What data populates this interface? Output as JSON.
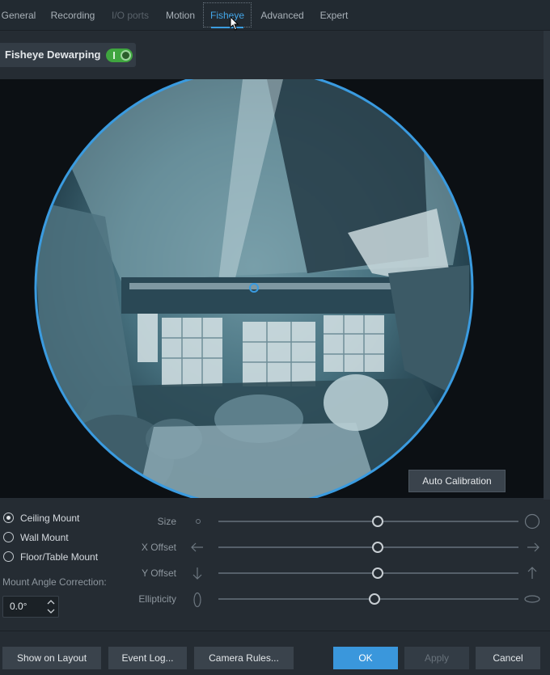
{
  "tabs": [
    {
      "label": "General",
      "state": "normal"
    },
    {
      "label": "Recording",
      "state": "normal"
    },
    {
      "label": "I/O ports",
      "state": "disabled"
    },
    {
      "label": "Motion",
      "state": "normal"
    },
    {
      "label": "Fisheye",
      "state": "active"
    },
    {
      "label": "Advanced",
      "state": "normal"
    },
    {
      "label": "Expert",
      "state": "normal"
    }
  ],
  "dewarping": {
    "label": "Fisheye Dewarping",
    "enabled": true
  },
  "video": {
    "auto_calibration_label": "Auto Calibration"
  },
  "mount": {
    "options": [
      {
        "label": "Ceiling Mount",
        "checked": true
      },
      {
        "label": "Wall Mount",
        "checked": false
      },
      {
        "label": "Floor/Table Mount",
        "checked": false
      }
    ],
    "angle_label": "Mount Angle Correction:",
    "angle_value": "0.0°"
  },
  "sliders": [
    {
      "label": "Size",
      "value": 0.53,
      "min_icon": "small-circle-icon",
      "max_icon": "large-circle-icon"
    },
    {
      "label": "X Offset",
      "value": 0.53,
      "min_icon": "arrow-left-icon",
      "max_icon": "arrow-right-icon"
    },
    {
      "label": "Y Offset",
      "value": 0.53,
      "min_icon": "arrow-down-icon",
      "max_icon": "arrow-up-icon"
    },
    {
      "label": "Ellipticity",
      "value": 0.52,
      "min_icon": "vertical-ellipse-icon",
      "max_icon": "horizontal-ellipse-icon"
    }
  ],
  "footer": {
    "show_on_layout": "Show on Layout",
    "event_log": "Event Log...",
    "camera_rules": "Camera Rules...",
    "ok": "OK",
    "apply": "Apply",
    "cancel": "Cancel"
  },
  "colors": {
    "accent": "#3a97dc",
    "toggle_on": "#3fa53f",
    "circle_outline": "#3a9be0"
  }
}
